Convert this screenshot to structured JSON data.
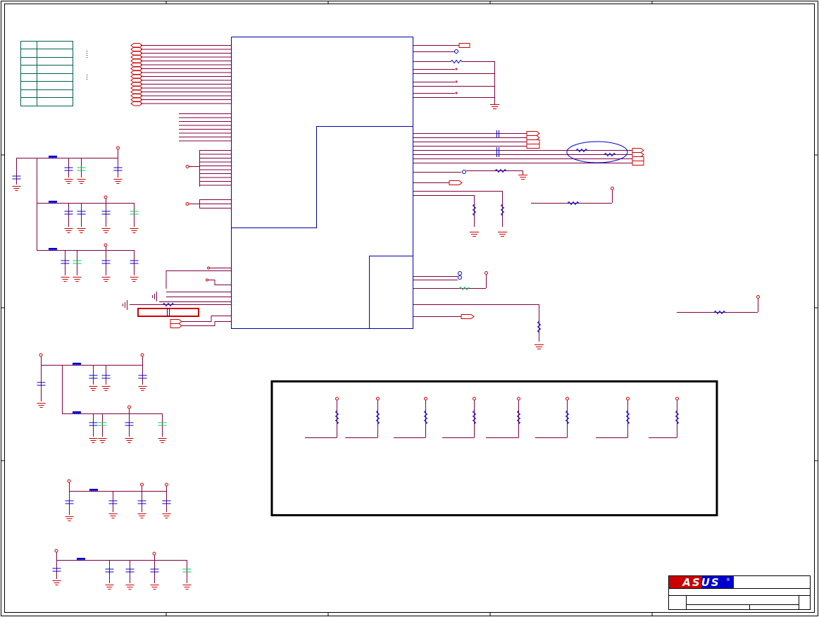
{
  "drawing": {
    "sheet_background": "#ffffff",
    "wire_color": "#800040",
    "symbol_color": "#cc0000",
    "component_color": "#0000cc",
    "highlight_color": "#00cc66",
    "frame_color": "#000000",
    "chip_outline_color": "#0000aa"
  },
  "title_block": {
    "logo_text": "ASUS",
    "logo_colors": {
      "left": "#cc0000",
      "right": "#0000cc",
      "text": "#ffffff"
    },
    "registered_mark": "®"
  },
  "icons": {
    "ground": "ground-icon",
    "power": "power-icon",
    "resistor": "resistor-icon",
    "capacitor": "capacitor-icon",
    "ferrite_bead": "ferrite-bead-icon",
    "off_page_connector": "off-page-connector-icon"
  }
}
